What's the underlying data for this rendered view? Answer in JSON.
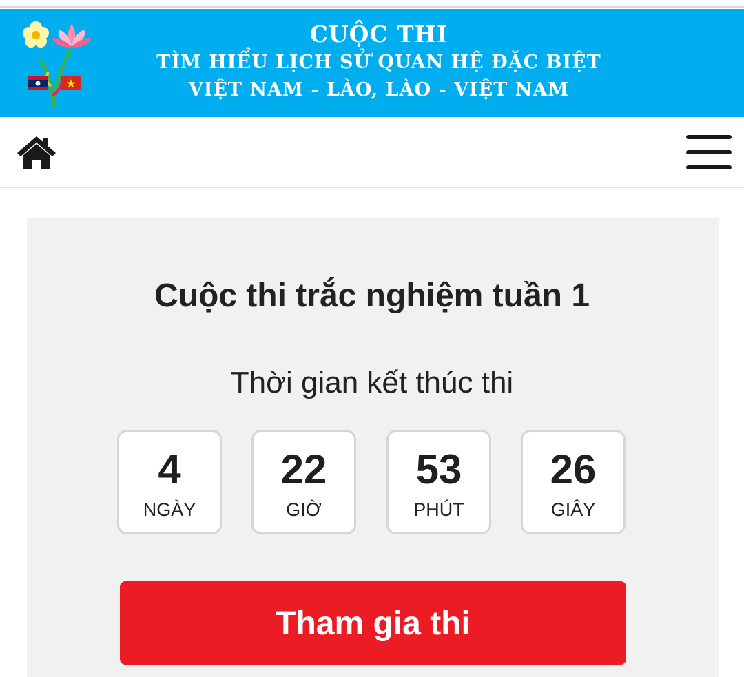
{
  "banner": {
    "line1": "Cuộc thi",
    "line2": "Tìm hiểu lịch sử quan hệ đặc biệt",
    "line3": "Việt Nam - Lào, Lào - Việt Nam",
    "background": "#00aeef",
    "logo_icon": "lotus-flower-flags-logo"
  },
  "navbar": {
    "home_icon": "home-icon",
    "menu_icon": "hamburger-menu-icon"
  },
  "contest": {
    "title": "Cuộc thi trắc nghiệm tuần 1",
    "end_label": "Thời gian kết thúc thi",
    "countdown": [
      {
        "value": "4",
        "unit": "NGÀY"
      },
      {
        "value": "22",
        "unit": "GIỜ"
      },
      {
        "value": "53",
        "unit": "PHÚT"
      },
      {
        "value": "26",
        "unit": "GIÂY"
      }
    ],
    "join_button": "Tham gia thi",
    "button_color": "#ec1c24"
  }
}
